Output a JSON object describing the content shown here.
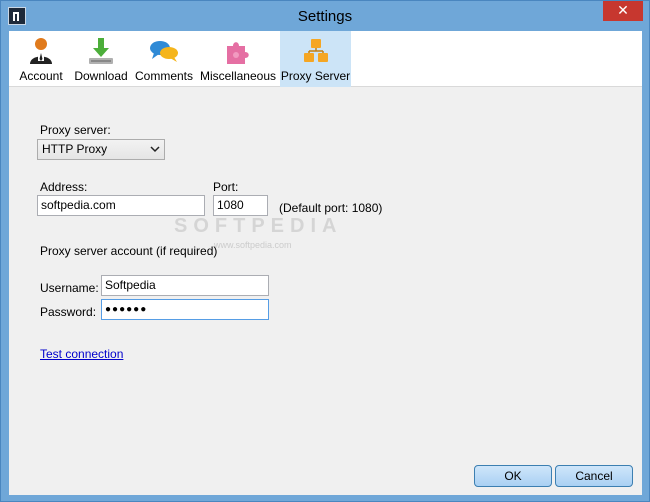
{
  "window": {
    "title": "Settings",
    "close_glyph": "✕"
  },
  "toolbar": {
    "tabs": [
      {
        "label": "Account",
        "icon": "account-icon"
      },
      {
        "label": "Download",
        "icon": "download-icon"
      },
      {
        "label": "Comments",
        "icon": "comments-icon"
      },
      {
        "label": "Miscellaneous",
        "icon": "puzzle-icon"
      },
      {
        "label": "Proxy Server",
        "icon": "proxy-server-icon",
        "active": true
      }
    ]
  },
  "proxy": {
    "server_label": "Proxy server:",
    "server_value": "HTTP Proxy",
    "address_label": "Address:",
    "address_value": "softpedia.com",
    "port_label": "Port:",
    "port_value": "1080",
    "default_port_note": "(Default port: 1080)",
    "account_heading": "Proxy server account (if required)",
    "username_label": "Username:",
    "username_value": "Softpedia",
    "password_label": "Password:",
    "password_value": "●●●●●●",
    "test_link": "Test connection"
  },
  "watermark": {
    "main": "SOFTPEDIA",
    "sub": "www.softpedia.com"
  },
  "buttons": {
    "ok": "OK",
    "cancel": "Cancel"
  },
  "colors": {
    "titlebar": "#6fa7d8",
    "active_tab": "#cce4f7",
    "close_button": "#c7372f",
    "link": "#0000cc"
  }
}
